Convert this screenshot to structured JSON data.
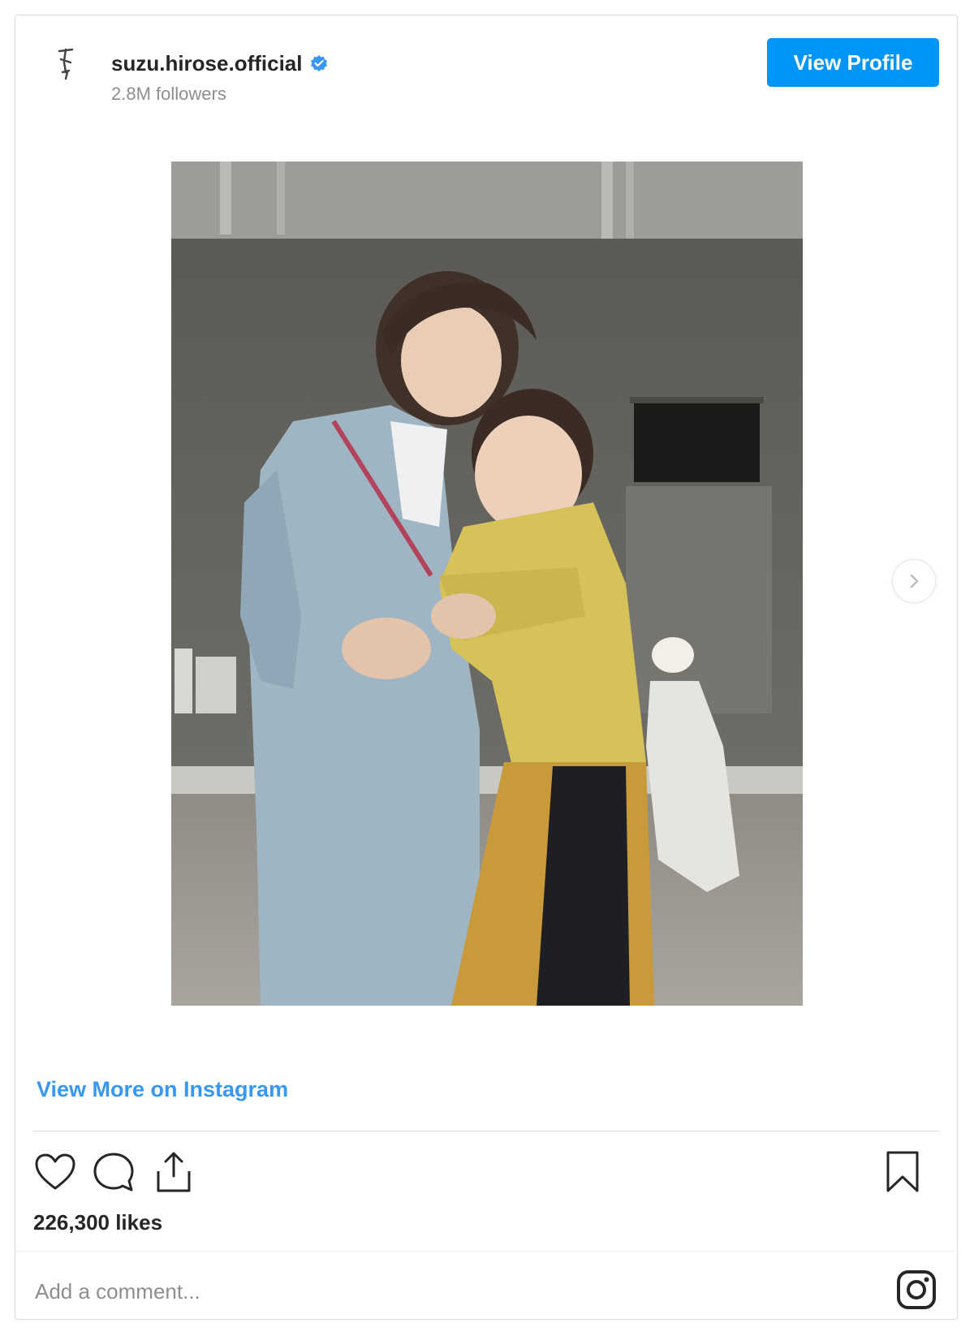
{
  "post": {
    "username": "suzu.hirose.official",
    "followers": "2.8M followers",
    "view_profile_label": "View Profile",
    "view_more_label": "View More on Instagram",
    "likes": "226,300 likes",
    "comment_placeholder": "Add a comment..."
  },
  "colors": {
    "accent": "#0095f6",
    "link": "#3897f0",
    "muted": "#8e8e8e",
    "border": "#dbdbdb"
  },
  "icons": {
    "verified": "verified-badge-icon",
    "like": "heart-icon",
    "comment": "comment-bubble-icon",
    "share": "share-upload-icon",
    "save": "bookmark-icon",
    "next": "chevron-right-icon",
    "brand": "instagram-logo-icon"
  }
}
